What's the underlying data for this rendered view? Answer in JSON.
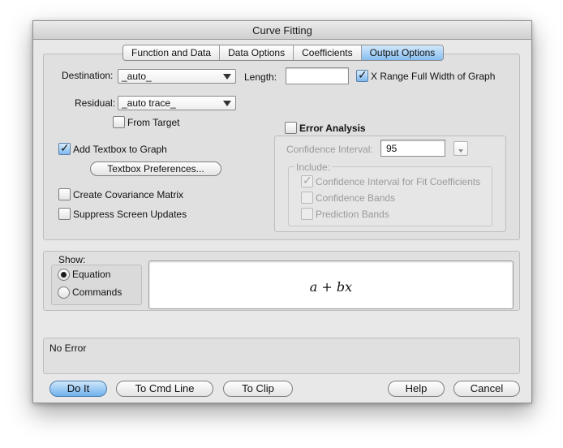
{
  "window": {
    "title": "Curve Fitting"
  },
  "tabs": [
    {
      "label": "Function and Data",
      "active": false
    },
    {
      "label": "Data Options",
      "active": false
    },
    {
      "label": "Coefficients",
      "active": false
    },
    {
      "label": "Output Options",
      "active": true
    }
  ],
  "output": {
    "destination": {
      "label": "Destination:",
      "value": "_auto_"
    },
    "length": {
      "label": "Length:",
      "value": ""
    },
    "x_range_full_width": {
      "label": "X Range Full Width of Graph",
      "checked": true
    },
    "residual": {
      "label": "Residual:",
      "value": "_auto trace_"
    },
    "from_target": {
      "label": "From Target",
      "checked": false
    },
    "add_textbox": {
      "label": "Add Textbox to Graph",
      "checked": true
    },
    "textbox_prefs_button": "Textbox Preferences...",
    "covariance": {
      "label": "Create Covariance Matrix",
      "checked": false
    },
    "suppress_updates": {
      "label": "Suppress Screen Updates",
      "checked": false
    }
  },
  "error_analysis": {
    "label": "Error Analysis",
    "checked": false,
    "confidence_interval": {
      "label": "Confidence Interval:",
      "value": "95"
    },
    "include": {
      "label": "Include:",
      "items": [
        {
          "label": "Confidence Interval for Fit Coefficients",
          "checked": true
        },
        {
          "label": "Confidence Bands",
          "checked": false
        },
        {
          "label": "Prediction Bands",
          "checked": false
        }
      ]
    }
  },
  "show": {
    "label": "Show:",
    "options": [
      {
        "label": "Equation",
        "selected": true
      },
      {
        "label": "Commands",
        "selected": false
      }
    ],
    "equation": "a + bx"
  },
  "status": {
    "text": "No Error"
  },
  "buttons": {
    "do_it": "Do It",
    "to_cmd_line": "To Cmd Line",
    "to_clip": "To Clip",
    "help": "Help",
    "cancel": "Cancel"
  },
  "icons": {
    "checkmark": "checkmark-icon",
    "popup_arrow": "chevron-down-icon"
  }
}
